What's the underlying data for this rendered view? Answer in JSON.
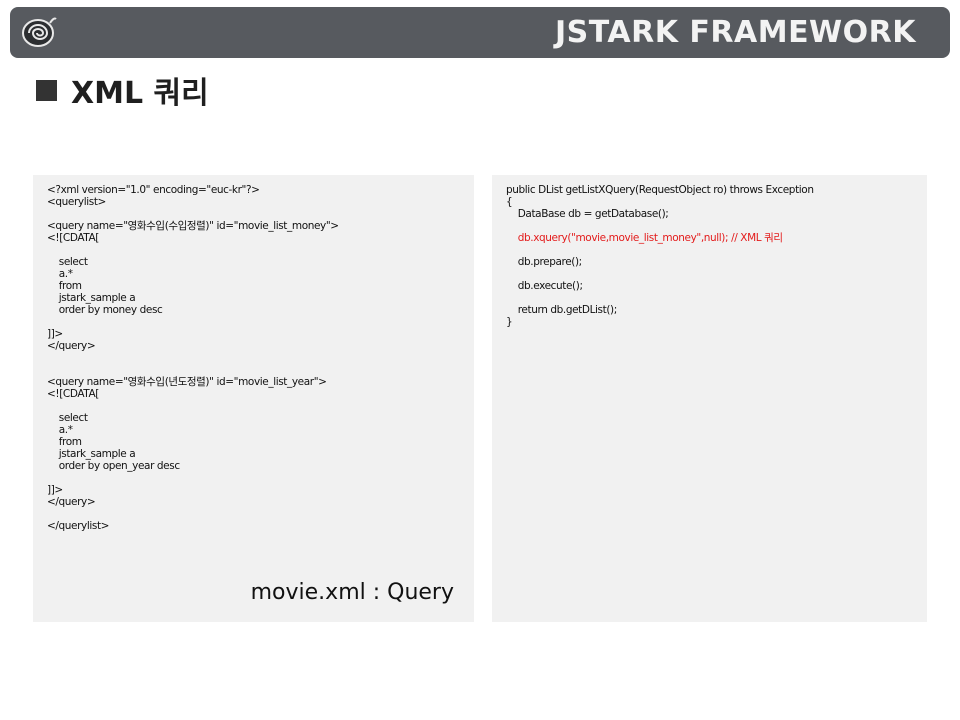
{
  "header": {
    "title": "JSTARK FRAMEWORK",
    "logo_icon": "snail-icon"
  },
  "section": {
    "title": "XML 쿼리"
  },
  "left_panel": {
    "lines": [
      "<?xml version=\"1.0\" encoding=\"euc-kr\"?>",
      "<querylist>",
      "",
      "<query name=\"영화수입(수입정렬)\" id=\"movie_list_money\">",
      "<![CDATA[",
      "",
      "    select",
      "    a.*",
      "    from",
      "    jstark_sample a",
      "    order by money desc",
      "",
      "]]>",
      "</query>",
      "",
      "",
      "<query name=\"영화수입(년도정렬)\" id=\"movie_list_year\">",
      "<![CDATA[",
      "",
      "    select",
      "    a.*",
      "    from",
      "    jstark_sample a",
      "    order by open_year desc",
      "",
      "]]>",
      "</query>",
      "",
      "</querylist>"
    ],
    "caption": "movie.xml : Query"
  },
  "right_panel": {
    "lines": [
      "public DList getListXQuery(RequestObject ro) throws Exception",
      "{",
      "    DataBase db = getDatabase();",
      "",
      "    db.xquery(\"movie,movie_list_money\",null); // XML 쿼리",
      "",
      "    db.prepare();",
      "",
      "    db.execute();",
      "",
      "    return db.getDList();",
      "}"
    ],
    "highlight_line": 4,
    "highlight_color": "#e31b1b"
  },
  "colors": {
    "header_bg": "#575a5f",
    "panel_bg": "#f1f1f1",
    "highlight": "#e31b1b"
  }
}
